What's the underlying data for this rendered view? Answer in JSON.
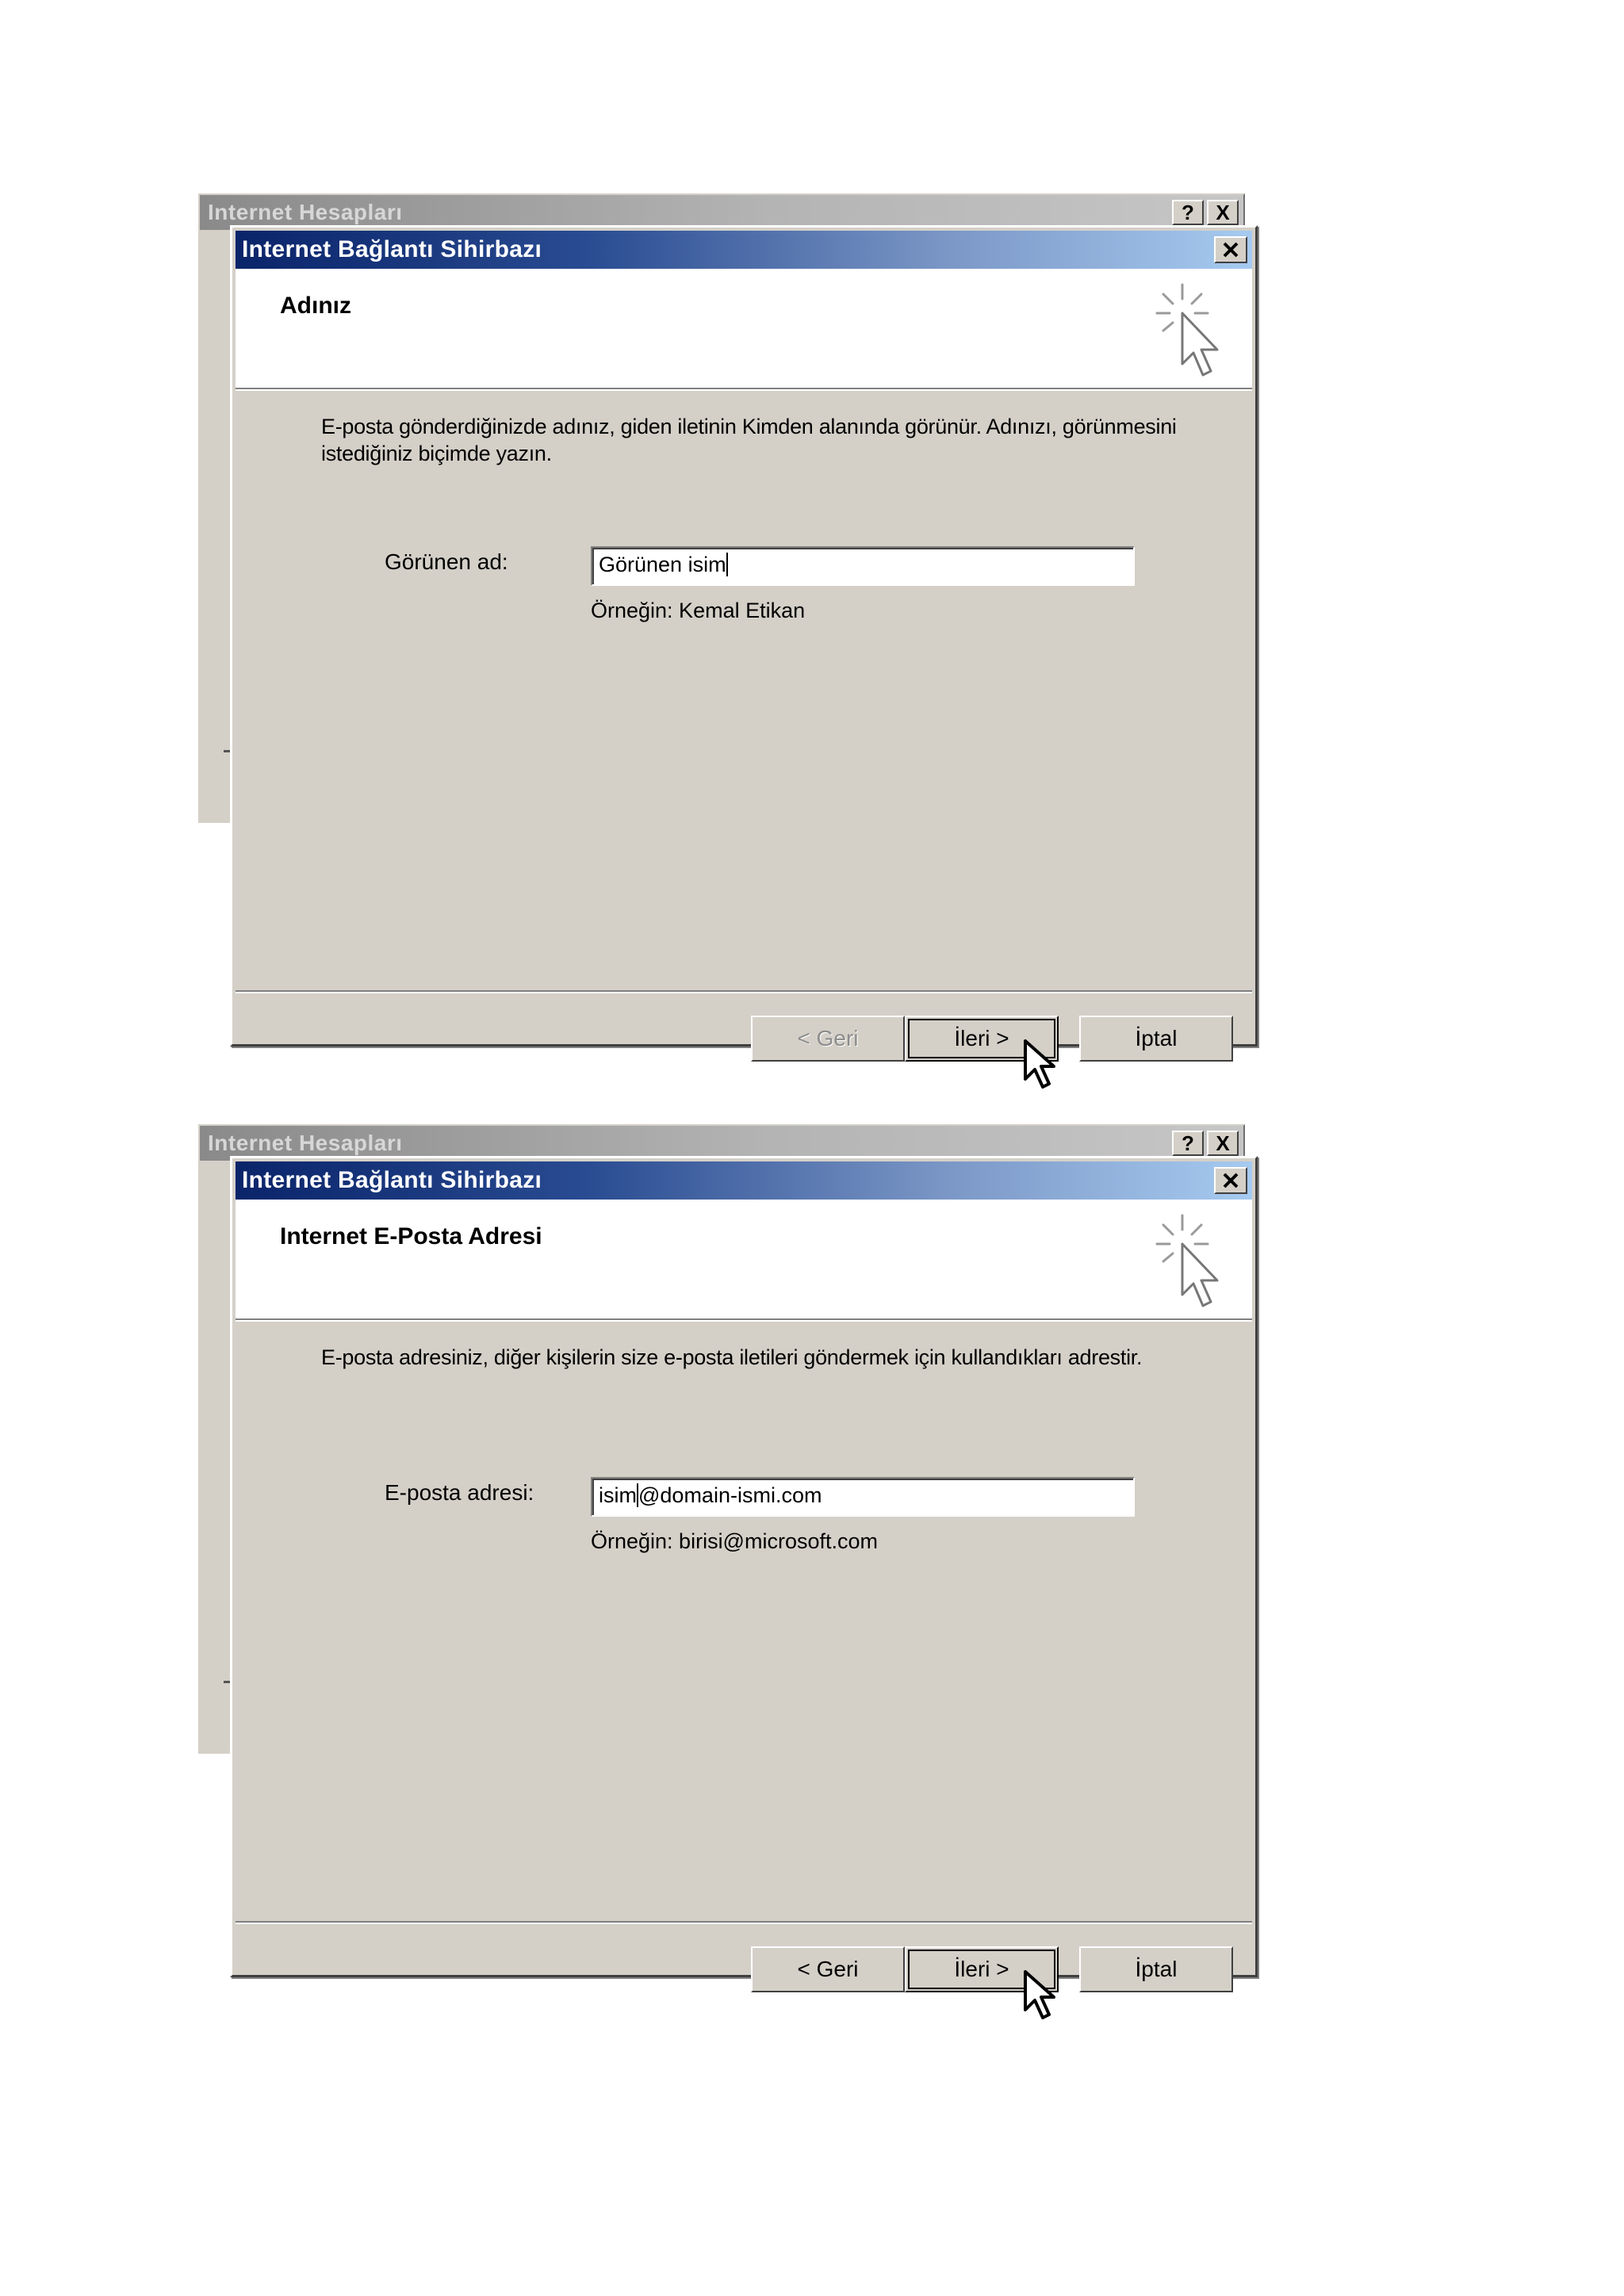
{
  "windows": [
    {
      "parent_title": "Internet Hesapları",
      "parent_controls": [
        "?",
        "X"
      ],
      "title": "Internet Bağlantı Sihirbazı",
      "header": "Adınız",
      "description": "E-posta gönderdiğinizde adınız, giden iletinin Kimden alanında görünür. Adınızı, görünmesini istediğiniz biçimde yazın.",
      "field_label": "Görünen ad:",
      "field_value_before_caret": "Görünen isim",
      "field_value_after_caret": "",
      "example": "Örneğin: Kemal Etikan",
      "buttons": {
        "back": "< Geri",
        "next": "İleri >",
        "cancel": "İptal"
      },
      "back_enabled": false
    },
    {
      "parent_title": "Internet Hesapları",
      "parent_controls": [
        "?",
        "X"
      ],
      "title": "Internet Bağlantı Sihirbazı",
      "header": "Internet E-Posta Adresi",
      "description": "E-posta adresiniz, diğer kişilerin size e-posta iletileri göndermek için kullandıkları adrestir.",
      "field_label": "E-posta adresi:",
      "field_value_before_caret": "isim",
      "field_value_after_caret": "@domain-ismi.com",
      "example": "Örneğin: birisi@microsoft.com",
      "buttons": {
        "back": "< Geri",
        "next": "İleri >",
        "cancel": "İptal"
      },
      "back_enabled": true
    }
  ],
  "icons": {
    "wizard": "wizard-sparkle-cursor-icon",
    "close": "close-icon",
    "pointer": "mouse-pointer-icon"
  },
  "colors": {
    "titlebar_start": "#0a246a",
    "titlebar_end": "#a6caf0",
    "dialog_face": "#d4d0c8"
  }
}
